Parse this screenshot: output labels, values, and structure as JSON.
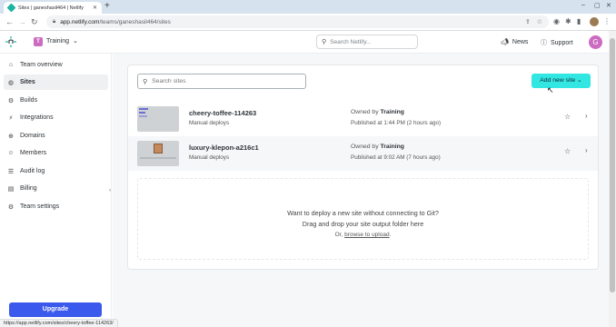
{
  "browser": {
    "tab_title": "Sites | ganeshasil464 | Netlify",
    "url_host": "app.netlify.com",
    "url_path": "/teams/ganeshasil464/sites",
    "status_url": "https://app.netlify.com/sites/cheery-toffee-114263/"
  },
  "header": {
    "team_initial": "T",
    "team_name": "Training",
    "search_placeholder": "Search Netlify...",
    "news_label": "News",
    "support_label": "Support",
    "avatar_initial": "G"
  },
  "sidebar": {
    "items": [
      {
        "label": "Team overview",
        "icon": "home-icon"
      },
      {
        "label": "Sites",
        "icon": "globe-icon"
      },
      {
        "label": "Builds",
        "icon": "builds-icon"
      },
      {
        "label": "Integrations",
        "icon": "integrations-icon"
      },
      {
        "label": "Domains",
        "icon": "domains-icon"
      },
      {
        "label": "Members",
        "icon": "members-icon"
      },
      {
        "label": "Audit log",
        "icon": "audit-log-icon"
      },
      {
        "label": "Billing",
        "icon": "billing-icon"
      },
      {
        "label": "Team settings",
        "icon": "gear-icon"
      }
    ],
    "active": "Sites",
    "upgrade_label": "Upgrade"
  },
  "main": {
    "search_placeholder": "Search sites",
    "add_site_label": "Add new site",
    "sites": [
      {
        "name": "cheery-toffee-114263",
        "deploy_type": "Manual deploys",
        "owned_prefix": "Owned by",
        "owner": "Training",
        "published": "Published at 1:44 PM (2 hours ago)"
      },
      {
        "name": "luxury-klepon-a216c1",
        "deploy_type": "Manual deploys",
        "owned_prefix": "Owned by",
        "owner": "Training",
        "published": "Published at 9:02 AM (7 hours ago)"
      }
    ],
    "drop": {
      "line1": "Want to deploy a new site without connecting to Git?",
      "line2": "Drag and drop your site output folder here",
      "or_text": "Or,",
      "browse_link": "browse to upload",
      "period": "."
    }
  },
  "colors": {
    "accent": "#32e6e2",
    "upgrade": "#3b59ec",
    "team_badge": "#cc6cc1"
  }
}
